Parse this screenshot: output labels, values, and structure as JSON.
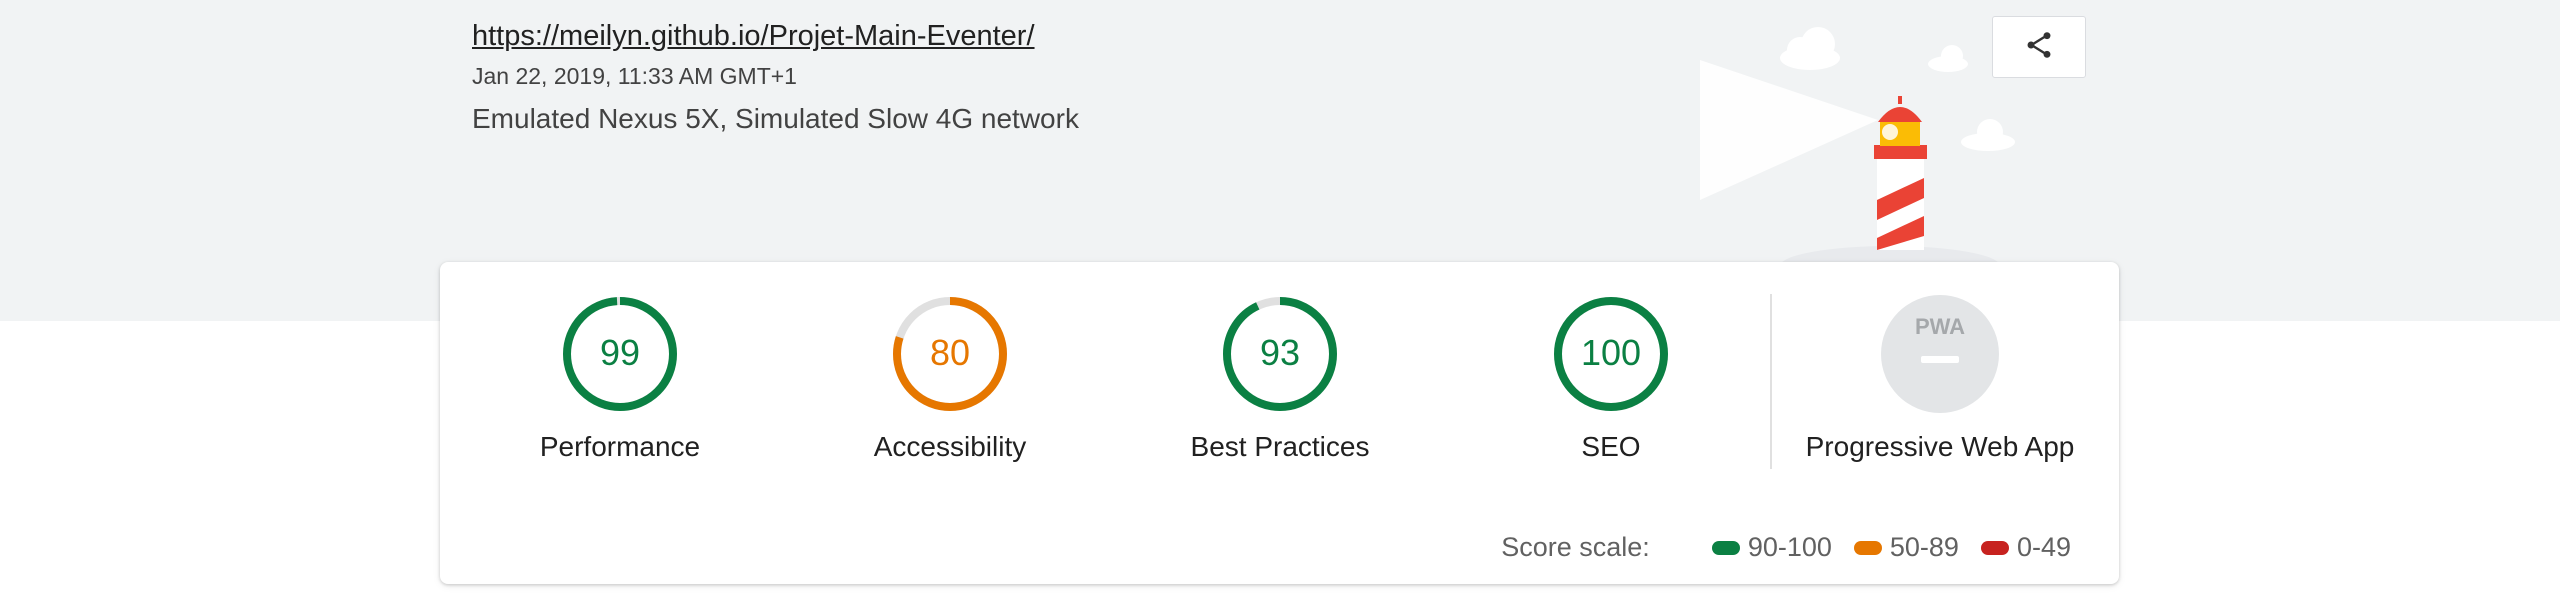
{
  "header": {
    "url": "https://meilyn.github.io/Projet-Main-Eventer/",
    "date": "Jan 22, 2019, 11:33 AM GMT+1",
    "environment": "Emulated Nexus 5X, Simulated Slow 4G network",
    "share_icon": "share-icon",
    "illustration": "lighthouse-illustration"
  },
  "categories": [
    {
      "score": "99",
      "label": "Performance",
      "value": 0.99,
      "color": "#0b8043"
    },
    {
      "score": "80",
      "label": "Accessibility",
      "value": 0.8,
      "color": "#e67700"
    },
    {
      "score": "93",
      "label": "Best Practices",
      "value": 0.93,
      "color": "#0b8043"
    },
    {
      "score": "100",
      "label": "SEO",
      "value": 1.0,
      "color": "#0b8043"
    }
  ],
  "pwa": {
    "badge": "PWA",
    "label": "Progressive Web App"
  },
  "score_scale": {
    "title": "Score scale:",
    "items": [
      {
        "range": "90-100",
        "color": "#0b8043"
      },
      {
        "range": "50-89",
        "color": "#e67700"
      },
      {
        "range": "0-49",
        "color": "#c7221f"
      }
    ]
  },
  "colors": {
    "track": "#e0e0e0",
    "background": "#f1f3f4"
  }
}
